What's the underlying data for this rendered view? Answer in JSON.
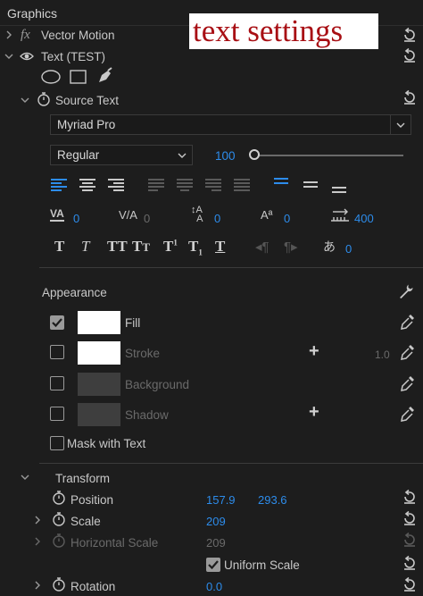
{
  "panel": {
    "title": "Graphics",
    "overlay_caption": "text settings"
  },
  "effects": {
    "vector_motion": "Vector Motion",
    "text_layer": "Text (TEST)",
    "source_text": "Source Text"
  },
  "font": {
    "family": "Myriad Pro",
    "style": "Regular",
    "size": "100",
    "size_fraction": 0.0
  },
  "metrics": {
    "kerning": "0",
    "tracking": "0",
    "leading": "0",
    "baseline_shift": "0",
    "tab_width": "400",
    "tsume": "0"
  },
  "appearance": {
    "heading": "Appearance",
    "fill": {
      "label": "Fill",
      "checked": true,
      "color": "#ffffff"
    },
    "stroke": {
      "label": "Stroke",
      "checked": false,
      "color": "#ffffff",
      "width": "1.0"
    },
    "background": {
      "label": "Background",
      "checked": false
    },
    "shadow": {
      "label": "Shadow",
      "checked": false
    },
    "mask_with_text": {
      "label": "Mask with Text",
      "checked": false
    }
  },
  "transform": {
    "heading": "Transform",
    "position": {
      "label": "Position",
      "x": "157.9",
      "y": "293.6"
    },
    "scale": {
      "label": "Scale",
      "value": "209"
    },
    "horizontal_scale": {
      "label": "Horizontal Scale",
      "value": "209"
    },
    "uniform_scale": {
      "label": "Uniform Scale",
      "checked": true
    },
    "rotation": {
      "label": "Rotation",
      "value": "0.0"
    }
  },
  "colors": {
    "accent": "#2d8ceb",
    "panel_bg": "#1d1d1d",
    "caption_text": "#a80f14"
  }
}
